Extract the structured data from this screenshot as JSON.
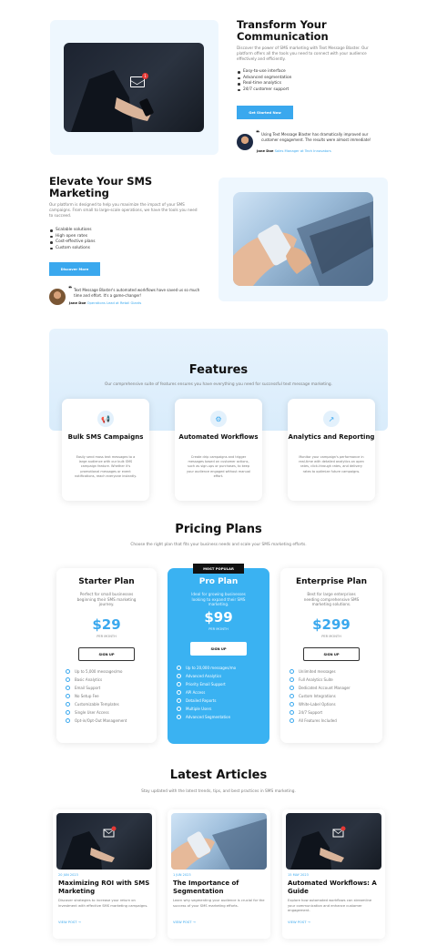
{
  "hero": {
    "title": "Transform Your Communication",
    "description": "Discover the power of SMS marketing with Text Message Blaster. Our platform offers all the tools you need to connect with your audience effectively and efficiently.",
    "features": [
      "Easy-to-use interface",
      "Advanced segmentation",
      "Real-time analytics",
      "24/7 customer support"
    ],
    "cta": "Get Started Now",
    "testimonial_quote": "Using Text Message Blaster has dramatically improved our customer engagement. The results were almost immediate!",
    "testimonial_author": "Jane Doe",
    "testimonial_role": "Sales Manager at Tech Innovators",
    "notification_count": "1"
  },
  "elevate": {
    "title": "Elevate Your SMS Marketing",
    "description": "Our platform is designed to help you maximize the impact of your SMS campaigns. From small to large-scale operations, we have the tools you need to succeed.",
    "features": [
      "Scalable solutions",
      "High open rates",
      "Cost-effective plans",
      "Custom solutions"
    ],
    "cta": "Discover More",
    "testimonial_quote": "Text Message Blaster's automated workflows have saved us so much time and effort. It's a game-changer!",
    "testimonial_author": "Jane Doe",
    "testimonial_role": "Operations Lead at Retail Giants"
  },
  "features": {
    "title": "Features",
    "subtitle": "Our comprehensive suite of features ensures you have everything you need for successful text message marketing.",
    "items": [
      {
        "icon": "megaphone-icon",
        "title": "Bulk SMS Campaigns",
        "description": "Easily send mass text messages to a large audience with our bulk SMS campaign feature. Whether it's promotional messages or event notifications, reach everyone instantly."
      },
      {
        "icon": "gears-icon",
        "title": "Automated Workflows",
        "description": "Create drip campaigns and trigger messages based on customer actions, such as sign-ups or purchases, to keep your audience engaged without manual effort."
      },
      {
        "icon": "chart-line-icon",
        "title": "Analytics and Reporting",
        "description": "Monitor your campaign's performance in real-time with detailed analytics on open rates, click-through rates, and delivery rates to optimize future campaigns."
      }
    ]
  },
  "pricing": {
    "title": "Pricing Plans",
    "subtitle": "Choose the right plan that fits your business needs and scale your SMS marketing efforts.",
    "badge": "MOST POPULAR",
    "plans": [
      {
        "name": "Starter Plan",
        "description": "Perfect for small businesses beginning their SMS marketing journey.",
        "price": "$29",
        "period": "PER MONTH",
        "button": "SIGN UP",
        "features": [
          "Up to 5,000 messages/mo",
          "Basic Analytics",
          "Email Support",
          "No Setup Fee",
          "Customizable Templates",
          "Single User Access",
          "Opt-in/Opt-Out Management"
        ]
      },
      {
        "name": "Pro Plan",
        "description": "Ideal for growing businesses looking to expand their SMS marketing.",
        "price": "$99",
        "period": "PER MONTH",
        "button": "SIGN UP",
        "features": [
          "Up to 20,000 messages/mo",
          "Advanced Analytics",
          "Priority Email Support",
          "API Access",
          "Detailed Reports",
          "Multiple Users",
          "Advanced Segmentation"
        ]
      },
      {
        "name": "Enterprise Plan",
        "description": "Best for large enterprises needing comprehensive SMS marketing solutions.",
        "price": "$299",
        "period": "PER MONTH",
        "button": "SIGN UP",
        "features": [
          "Unlimited messages",
          "Full Analytics Suite",
          "Dedicated Account Manager",
          "Custom Integrations",
          "White-Label Options",
          "24/7 Support",
          "All Features Included"
        ]
      }
    ]
  },
  "articles": {
    "title": "Latest Articles",
    "subtitle": "Stay updated with the latest trends, tips, and best practices in SMS marketing.",
    "items": [
      {
        "date": "20 JUN 2023",
        "title": "Maximizing ROI with SMS Marketing",
        "description": "Discover strategies to increase your return on investment with effective SMS marketing campaigns.",
        "link": "VIEW POST"
      },
      {
        "date": "1 JUN 2023",
        "title": "The Importance of Segmentation",
        "description": "Learn why segmenting your audience is crucial for the success of your SMS marketing efforts.",
        "link": "VIEW POST"
      },
      {
        "date": "15 MAY 2023",
        "title": "Automated Workflows: A Guide",
        "description": "Explore how automated workflows can streamline your communication and enhance customer engagement.",
        "link": "VIEW POST"
      }
    ]
  },
  "colors": {
    "accent": "#3aa8ee",
    "panel": "#eef7fe",
    "dark": "#111111"
  }
}
